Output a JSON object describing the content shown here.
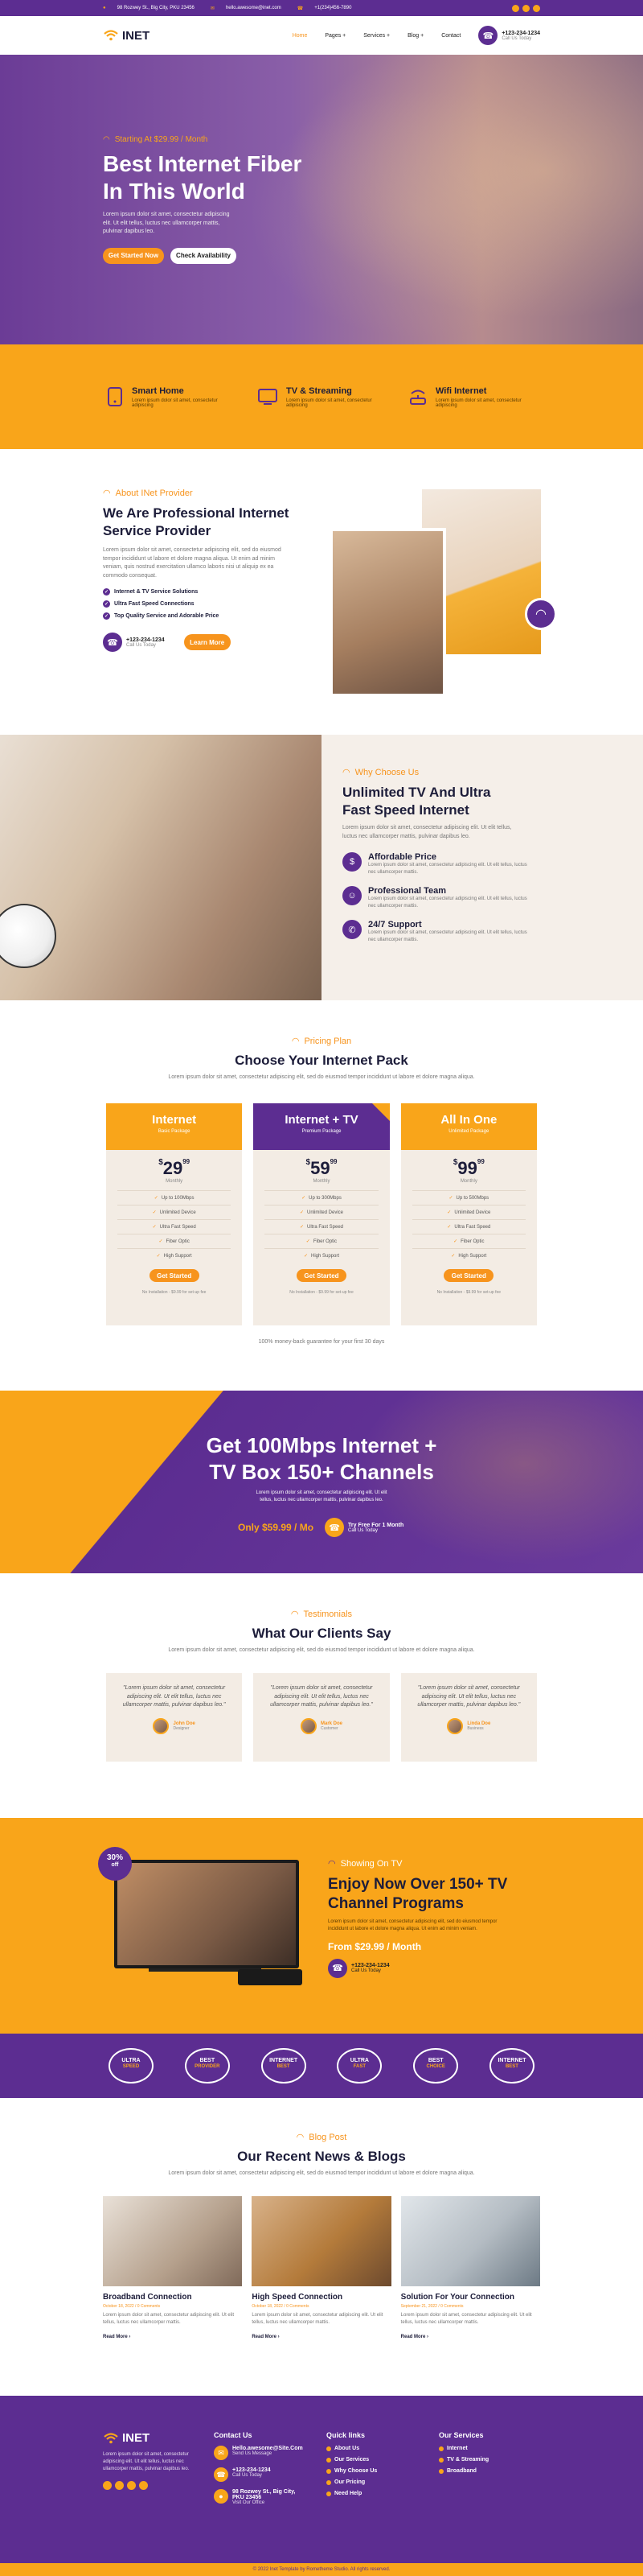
{
  "topbar": {
    "address": "98 Rozwey St., Big City, PKU 23456",
    "email": "hello.awesome@inet.com",
    "phone": "+1(234)456-7890"
  },
  "nav": {
    "logo": "INET",
    "items": [
      {
        "label": "Home",
        "active": true
      },
      {
        "label": "Pages +"
      },
      {
        "label": "Services +"
      },
      {
        "label": "Blog +"
      },
      {
        "label": "Contact"
      }
    ],
    "phone": "+123-234-1234",
    "phone_sub": "Call Us Today"
  },
  "hero": {
    "eyebrow": "Starting At $29.99 / Month",
    "title_l1": "Best Internet Fiber",
    "title_l2": "In This World",
    "desc": "Lorem ipsum dolor sit amet, consectetur adipiscing elit. Ut elit tellus, luctus nec ullamcorper mattis, pulvinar dapibus leo.",
    "cta_primary": "Get Started Now",
    "cta_secondary": "Check Availability"
  },
  "features": [
    {
      "icon": "smart-home-icon",
      "title": "Smart Home",
      "desc": "Lorem ipsum dolor sit amet, consectetur adipiscing"
    },
    {
      "icon": "tv-icon",
      "title": "TV & Streaming",
      "desc": "Lorem ipsum dolor sit amet, consectetur adipiscing"
    },
    {
      "icon": "router-icon",
      "title": "Wifi Internet",
      "desc": "Lorem ipsum dolor sit amet, consectetur adipiscing"
    }
  ],
  "about": {
    "eyebrow": "About INet Provider",
    "title_l1": "We Are Professional Internet",
    "title_l2": "Service Provider",
    "desc": "Lorem ipsum dolor sit amet, consectetur adipiscing elit, sed do eiusmod tempor incididunt ut labore et dolore magna aliqua. Ut enim ad minim veniam, quis nostrud exercitation ullamco laboris nisi ut aliquip ex ea commodo consequat.",
    "checks": [
      "Internet & TV Service Solutions",
      "Ultra Fast Speed Connections",
      "Top Quality Service and Adorable Price"
    ],
    "phone": "+123-234-1234",
    "phone_sub": "Call Us Today",
    "cta": "Learn More"
  },
  "why": {
    "eyebrow": "Why Choose Us",
    "title_l1": "Unlimited TV And Ultra",
    "title_l2": "Fast Speed Internet",
    "desc": "Lorem ipsum dolor sit amet, consectetur adipiscing elit. Ut elit tellus, luctus nec ullamcorper mattis, pulvinar dapibus leo.",
    "items": [
      {
        "title": "Affordable Price",
        "desc": "Lorem ipsum dolor sit amet, consectetur adipiscing elit. Ut elit tellus, luctus nec ullamcorper mattis."
      },
      {
        "title": "Professional Team",
        "desc": "Lorem ipsum dolor sit amet, consectetur adipiscing elit. Ut elit tellus, luctus nec ullamcorper mattis."
      },
      {
        "title": "24/7 Support",
        "desc": "Lorem ipsum dolor sit amet, consectetur adipiscing elit. Ut elit tellus, luctus nec ullamcorper mattis."
      }
    ]
  },
  "pricing": {
    "eyebrow": "Pricing Plan",
    "title": "Choose Your Internet Pack",
    "desc": "Lorem ipsum dolor sit amet, consectetur adipiscing elit, sed do eiusmod tempor incididunt ut labore et dolore magna aliqua.",
    "plans": [
      {
        "name": "Internet",
        "sub": "Basic Package",
        "price": "29",
        "cents": "99",
        "period": "Monthly",
        "features": [
          "Up to 100Mbps",
          "Unlimited Device",
          "Ultra Fast Speed",
          "Fiber Optic",
          "High Support"
        ],
        "cta": "Get Started",
        "note": "No Installation - $9.99 for set-up fee",
        "featured": false
      },
      {
        "name": "Internet + TV",
        "sub": "Premium Package",
        "price": "59",
        "cents": "99",
        "period": "Monthly",
        "features": [
          "Up to 300Mbps",
          "Unlimited Device",
          "Ultra Fast Speed",
          "Fiber Optic",
          "High Support"
        ],
        "cta": "Get Started",
        "note": "No Installation - $9.99 for set-up fee",
        "featured": true
      },
      {
        "name": "All In One",
        "sub": "Unlimited Package",
        "price": "99",
        "cents": "99",
        "period": "Monthly",
        "features": [
          "Up to 500Mbps",
          "Unlimited Device",
          "Ultra Fast Speed",
          "Fiber Optic",
          "High Support"
        ],
        "cta": "Get Started",
        "note": "No Installation - $9.99 for set-up fee",
        "featured": false
      }
    ],
    "guarantee": "100% money-back guarantee for your first 30 days"
  },
  "promo": {
    "title_l1": "Get 100Mbps Internet +",
    "title_l2": "TV Box 150+ Channels",
    "desc": "Lorem ipsum dolor sit amet, consectetur adipiscing elit. Ut elit tellus, luctus nec ullamcorper mattis, pulvinar dapibus leo.",
    "price": "Only $59.99 / Mo",
    "cta": "Try Free For 1 Month",
    "cta_sub": "Call Us Today"
  },
  "testimonials": {
    "eyebrow": "Testimonials",
    "title": "What Our Clients Say",
    "desc": "Lorem ipsum dolor sit amet, consectetur adipiscing elit, sed do eiusmod tempor incididunt ut labore et dolore magna aliqua.",
    "items": [
      {
        "quote": "\"Lorem ipsum dolor sit amet, consectetur adipiscing elit. Ut elit tellus, luctus nec ullamcorper mattis, pulvinar dapibus leo.\"",
        "name": "John Doe",
        "role": "Designer"
      },
      {
        "quote": "\"Lorem ipsum dolor sit amet, consectetur adipiscing elit. Ut elit tellus, luctus nec ullamcorper mattis, pulvinar dapibus leo.\"",
        "name": "Mark Doe",
        "role": "Customer"
      },
      {
        "quote": "\"Lorem ipsum dolor sit amet, consectetur adipiscing elit. Ut elit tellus, luctus nec ullamcorper mattis, pulvinar dapibus leo.\"",
        "name": "Linda Doe",
        "role": "Business"
      }
    ]
  },
  "tvpromo": {
    "badge_l1": "30%",
    "badge_l2": "off",
    "eyebrow": "Showing On TV",
    "title_l1": "Enjoy Now Over 150+ TV",
    "title_l2": "Channel Programs",
    "desc": "Lorem ipsum dolor sit amet, consectetur adipiscing elit, sed do eiusmod tempor incididunt ut labore et dolore magna aliqua. Ut enim ad minim veniam.",
    "price": "From $29.99 / Month",
    "phone": "+123-234-1234",
    "phone_sub": "Call Us Today"
  },
  "badges": [
    {
      "l1": "ULTRA",
      "l2": "SPEED"
    },
    {
      "l1": "BEST",
      "l2": "PROVIDER"
    },
    {
      "l1": "INTERNET",
      "l2": "BEST"
    },
    {
      "l1": "ULTRA",
      "l2": "FAST"
    },
    {
      "l1": "BEST",
      "l2": "CHOICE"
    },
    {
      "l1": "INTERNET",
      "l2": "BEST"
    }
  ],
  "blog": {
    "eyebrow": "Blog Post",
    "title": "Our Recent News & Blogs",
    "desc": "Lorem ipsum dolor sit amet, consectetur adipiscing elit, sed do eiusmod tempor incididunt ut labore et dolore magna aliqua.",
    "posts": [
      {
        "title": "Broadband Connection",
        "meta": "October 18, 2022 / 0 Comments",
        "desc": "Lorem ipsum dolor sit amet, consectetur adipiscing elit. Ut elit tellus, luctus nec ullamcorper mattis.",
        "more": "Read More ›"
      },
      {
        "title": "High Speed Connection",
        "meta": "October 18, 2022 / 0 Comments",
        "desc": "Lorem ipsum dolor sit amet, consectetur adipiscing elit. Ut elit tellus, luctus nec ullamcorper mattis.",
        "more": "Read More ›"
      },
      {
        "title": "Solution For Your Connection",
        "meta": "September 21, 2022 / 0 Comments",
        "desc": "Lorem ipsum dolor sit amet, consectetur adipiscing elit. Ut elit tellus, luctus nec ullamcorper mattis.",
        "more": "Read More ›"
      }
    ]
  },
  "footer": {
    "logo": "INET",
    "desc": "Lorem ipsum dolor sit amet, consectetur adipiscing elit. Ut elit tellus, luctus nec ullamcorper mattis, pulvinar dapibus leo.",
    "contact_title": "Contact Us",
    "contact": [
      {
        "l1": "Hello.awesome@Site.Com",
        "l2": "Send Us Message"
      },
      {
        "l1": "+123-234-1234",
        "l2": "Call Us Today"
      },
      {
        "l1": "98 Rozwey St., Big City, PKU 23456",
        "l2": "Visit Our Office"
      }
    ],
    "links_title": "Quick links",
    "links": [
      "About Us",
      "Our Services",
      "Why Choose Us",
      "Our Pricing",
      "Need Help"
    ],
    "services_title": "Our Services",
    "services": [
      "Internet",
      "TV & Streaming",
      "Broadband"
    ],
    "copyright": "© 2022 Inet Template by Rometheme Studio. All rights reserved."
  },
  "colors": {
    "purple": "#5c2d91",
    "orange": "#f9a51a",
    "accent": "#f7941d"
  }
}
